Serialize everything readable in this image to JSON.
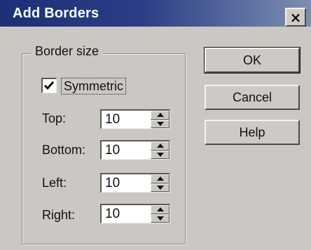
{
  "window": {
    "title": "Add Borders",
    "close_glyph": "×"
  },
  "group": {
    "legend": "Border size"
  },
  "symmetric": {
    "label": "Symmetric",
    "checked": true
  },
  "fields": {
    "top": {
      "label": "Top:",
      "value": "10"
    },
    "bottom": {
      "label": "Bottom:",
      "value": "10"
    },
    "left": {
      "label": "Left:",
      "value": "10"
    },
    "right": {
      "label": "Right:",
      "value": "10"
    }
  },
  "buttons": {
    "ok": "OK",
    "cancel": "Cancel",
    "help": "Help"
  },
  "icons": {
    "close": "close-icon",
    "check": "checkmark-icon",
    "spin_up": "arrow-up-icon",
    "spin_down": "arrow-down-icon"
  },
  "colors": {
    "titlebar_start": "#1c2f77",
    "titlebar_end": "#7d8fb0",
    "dialog_face": "#cbc8c3"
  }
}
